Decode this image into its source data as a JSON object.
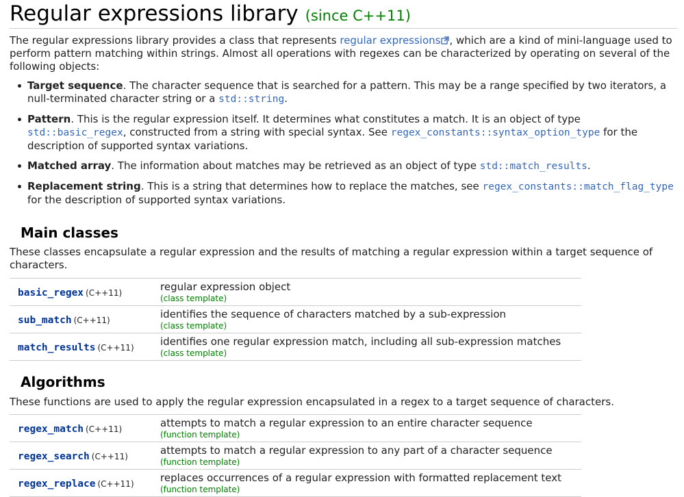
{
  "page": {
    "title": "Regular expressions library",
    "since": "(since C++11)"
  },
  "intro": {
    "text_before_link": "The regular expressions library provides a class that represents ",
    "link": "regular expressions",
    "text_after_link": ", which are a kind of mini-language used to perform pattern matching within strings. Almost all operations with regexes can be characterized by operating on several of the following objects:"
  },
  "objects": [
    {
      "term": "Target sequence",
      "text1": ". The character sequence that is searched for a pattern. This may be a range specified by two iterators, a null-terminated character string or a ",
      "code1": "std::string",
      "text2": ".",
      "code2": "",
      "text3": ""
    },
    {
      "term": "Pattern",
      "text1": ". This is the regular expression itself. It determines what constitutes a match. It is an object of type ",
      "code1": "std::basic_regex",
      "text2": ", constructed from a string with special syntax. See ",
      "code2": "regex_constants::syntax_option_type",
      "text3": " for the description of supported syntax variations."
    },
    {
      "term": "Matched array",
      "text1": ". The information about matches may be retrieved as an object of type ",
      "code1": "std::match_results",
      "text2": ".",
      "code2": "",
      "text3": ""
    },
    {
      "term": "Replacement string",
      "text1": ". This is a string that determines how to replace the matches, see ",
      "code1": "regex_constants::match_flag_type",
      "text2": " for the description of supported syntax variations.",
      "code2": "",
      "text3": ""
    }
  ],
  "main_classes": {
    "heading": "Main classes",
    "description": "These classes encapsulate a regular expression and the results of matching a regular expression within a target sequence of characters.",
    "rows": [
      {
        "name": "basic_regex",
        "version": "(C++11)",
        "description": "regular expression object",
        "kind": "(class template)"
      },
      {
        "name": "sub_match",
        "version": "(C++11)",
        "description": "identifies the sequence of characters matched by a sub-expression",
        "kind": "(class template)"
      },
      {
        "name": "match_results",
        "version": "(C++11)",
        "description": "identifies one regular expression match, including all sub-expression matches",
        "kind": "(class template)"
      }
    ]
  },
  "algorithms": {
    "heading": "Algorithms",
    "description": "These functions are used to apply the regular expression encapsulated in a regex to a target sequence of characters.",
    "rows": [
      {
        "name": "regex_match",
        "version": "(C++11)",
        "description": "attempts to match a regular expression to an entire character sequence",
        "kind": "(function template)"
      },
      {
        "name": "regex_search",
        "version": "(C++11)",
        "description": "attempts to match a regular expression to any part of a character sequence",
        "kind": "(function template)"
      },
      {
        "name": "regex_replace",
        "version": "(C++11)",
        "description": "replaces occurrences of a regular expression with formatted replacement text",
        "kind": "(function template)"
      }
    ]
  },
  "icons": {
    "external_link": "external-link-icon"
  },
  "colors": {
    "link": "#3366bb",
    "member_name": "#003399",
    "since": "#008000"
  }
}
